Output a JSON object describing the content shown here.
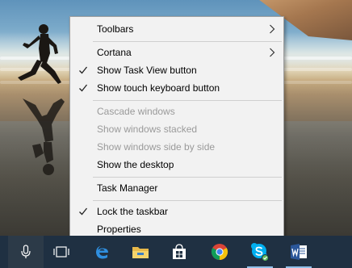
{
  "context_menu": {
    "items": [
      {
        "label": "Toolbars",
        "checked": false,
        "disabled": false,
        "submenu": true
      },
      {
        "label": "Cortana",
        "checked": false,
        "disabled": false,
        "submenu": true
      },
      {
        "label": "Show Task View button",
        "checked": true,
        "disabled": false,
        "submenu": false
      },
      {
        "label": "Show touch keyboard button",
        "checked": true,
        "disabled": false,
        "submenu": false
      },
      {
        "label": "Cascade windows",
        "checked": false,
        "disabled": true,
        "submenu": false
      },
      {
        "label": "Show windows stacked",
        "checked": false,
        "disabled": true,
        "submenu": false
      },
      {
        "label": "Show windows side by side",
        "checked": false,
        "disabled": true,
        "submenu": false
      },
      {
        "label": "Show the desktop",
        "checked": false,
        "disabled": false,
        "submenu": false
      },
      {
        "label": "Task Manager",
        "checked": false,
        "disabled": false,
        "submenu": false
      },
      {
        "label": "Lock the taskbar",
        "checked": true,
        "disabled": false,
        "submenu": false
      },
      {
        "label": "Properties",
        "checked": false,
        "disabled": false,
        "submenu": false
      }
    ]
  },
  "taskbar": {
    "buttons": [
      {
        "icon": "microphone-icon",
        "active": true
      },
      {
        "icon": "task-view-icon",
        "active": false
      },
      {
        "icon": "edge-icon",
        "active": false
      },
      {
        "icon": "file-explorer-icon",
        "active": false
      },
      {
        "icon": "store-icon",
        "active": false
      },
      {
        "icon": "chrome-icon",
        "active": false
      },
      {
        "icon": "skype-icon",
        "active": false
      },
      {
        "icon": "word-icon",
        "active": false
      }
    ]
  },
  "colors": {
    "menu_background": "#f2f2f2",
    "menu_border": "#a0a0a0",
    "disabled_text": "#9a9a9a",
    "taskbar": "#1f3042",
    "running_indicator": "#8fbfe8"
  }
}
